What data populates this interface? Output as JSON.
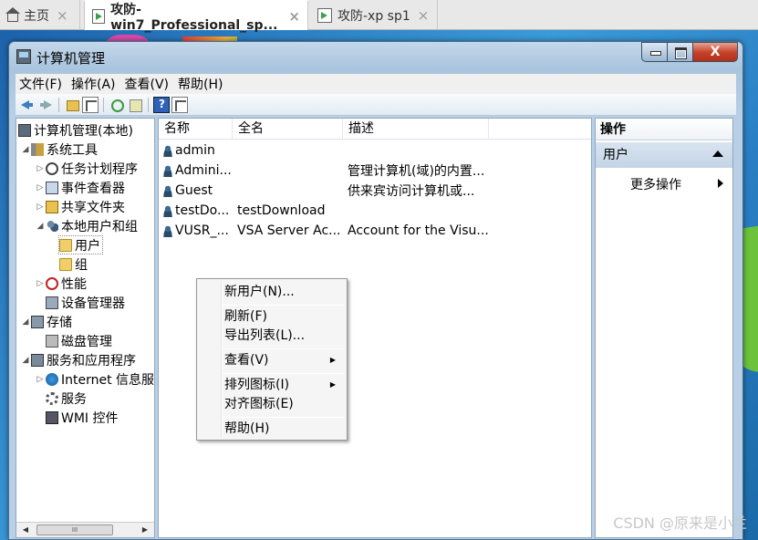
{
  "vm_tabs": [
    {
      "label": "主页",
      "icon": "home-icon"
    },
    {
      "label": "攻防-win7_Professional_sp...",
      "icon": "vm-icon"
    },
    {
      "label": "攻防-xp sp1",
      "icon": "vm-icon"
    }
  ],
  "close_glyph": "×",
  "window": {
    "title": "计算机管理",
    "close_label": "X"
  },
  "menu": [
    "文件(F)",
    "操作(A)",
    "查看(V)",
    "帮助(H)"
  ],
  "tree": {
    "items": [
      {
        "label": "计算机管理(本地)",
        "icon": "computer-icon"
      },
      {
        "label": "系统工具",
        "icon": "tools-icon"
      },
      {
        "label": "任务计划程序",
        "icon": "clock-icon"
      },
      {
        "label": "事件查看器",
        "icon": "event-viewer-icon"
      },
      {
        "label": "共享文件夹",
        "icon": "shared-folder-icon"
      },
      {
        "label": "本地用户和组",
        "icon": "users-icon"
      },
      {
        "label": "用户",
        "icon": "folder-icon"
      },
      {
        "label": "组",
        "icon": "folder-icon"
      },
      {
        "label": "性能",
        "icon": "performance-icon"
      },
      {
        "label": "设备管理器",
        "icon": "device-manager-icon"
      },
      {
        "label": "存储",
        "icon": "storage-icon"
      },
      {
        "label": "磁盘管理",
        "icon": "disk-icon"
      },
      {
        "label": "服务和应用程序",
        "icon": "services-apps-icon"
      },
      {
        "label": "Internet 信息服",
        "icon": "globe-icon"
      },
      {
        "label": "服务",
        "icon": "gear-icon"
      },
      {
        "label": "WMI 控件",
        "icon": "wmi-icon"
      }
    ],
    "scroll_thumb": "III"
  },
  "list": {
    "columns": [
      "名称",
      "全名",
      "描述"
    ],
    "rows": [
      {
        "name": "admin",
        "fullname": "",
        "desc": ""
      },
      {
        "name": "Admini...",
        "fullname": "",
        "desc": "管理计算机(域)的内置..."
      },
      {
        "name": "Guest",
        "fullname": "",
        "desc": "供来宾访问计算机或..."
      },
      {
        "name": "testDo...",
        "fullname": "testDownload",
        "desc": ""
      },
      {
        "name": "VUSR_...",
        "fullname": "VSA Server Ac...",
        "desc": "Account for the Visu..."
      }
    ]
  },
  "context_menu": {
    "new_user": "新用户(N)...",
    "refresh": "刷新(F)",
    "export": "导出列表(L)...",
    "view": "查看(V)",
    "arrange": "排列图标(I)",
    "align": "对齐图标(E)",
    "help": "帮助(H)"
  },
  "actions": {
    "title": "操作",
    "group": "用户",
    "more": "更多操作"
  },
  "watermark": "CSDN @原来是小兰"
}
